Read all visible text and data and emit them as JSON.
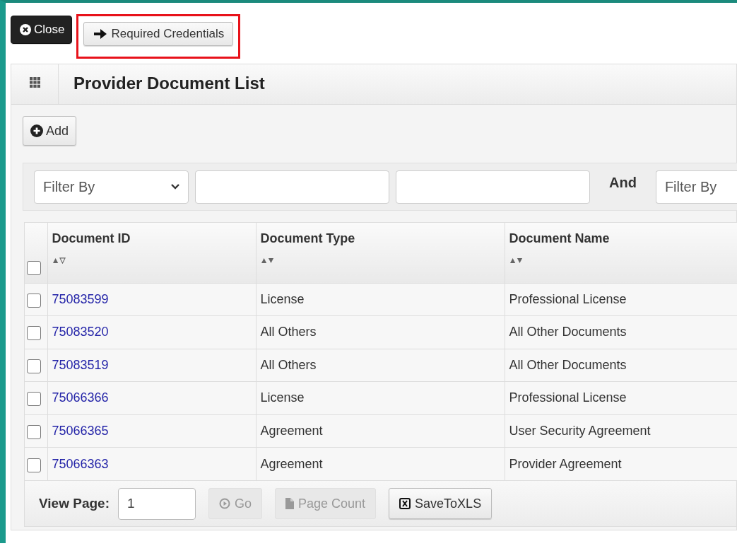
{
  "toolbar": {
    "buttons": [
      {
        "kind": "close",
        "label": "Close",
        "highlighted": false
      },
      {
        "kind": "arrow",
        "label": "Required Credentials",
        "highlighted": true
      }
    ]
  },
  "panel": {
    "title": "Provider Document List",
    "add_button": "Add",
    "filter": {
      "selects": [
        {
          "placeholder": "Filter By"
        },
        {
          "placeholder": "Filter By"
        }
      ],
      "joiner": "And"
    },
    "table": {
      "select_all": {
        "checked": false
      },
      "columns": [
        {
          "label": "Document ID",
          "sorted": true
        },
        {
          "label": "Document Type",
          "sorted": false
        },
        {
          "label": "Document Name",
          "sorted": false
        }
      ],
      "rows": [
        {
          "checked": false,
          "id": "75083599",
          "type": "License",
          "name": "Professional License"
        },
        {
          "checked": false,
          "id": "75083520",
          "type": "All Others",
          "name": "All Other Documents"
        },
        {
          "checked": false,
          "id": "75083519",
          "type": "All Others",
          "name": "All Other Documents"
        },
        {
          "checked": false,
          "id": "75066366",
          "type": "License",
          "name": "Professional License"
        },
        {
          "checked": false,
          "id": "75066365",
          "type": "Agreement",
          "name": "User Security Agreement"
        },
        {
          "checked": false,
          "id": "75066363",
          "type": "Agreement",
          "name": "Provider Agreement"
        }
      ]
    },
    "pager": {
      "label": "View Page:",
      "page": "1",
      "buttons": [
        {
          "kind": "go",
          "label": "Go",
          "disabled": true
        },
        {
          "kind": "count",
          "label": "Page Count",
          "disabled": true
        },
        {
          "kind": "xls",
          "label": "SaveToXLS",
          "disabled": false
        }
      ]
    }
  }
}
